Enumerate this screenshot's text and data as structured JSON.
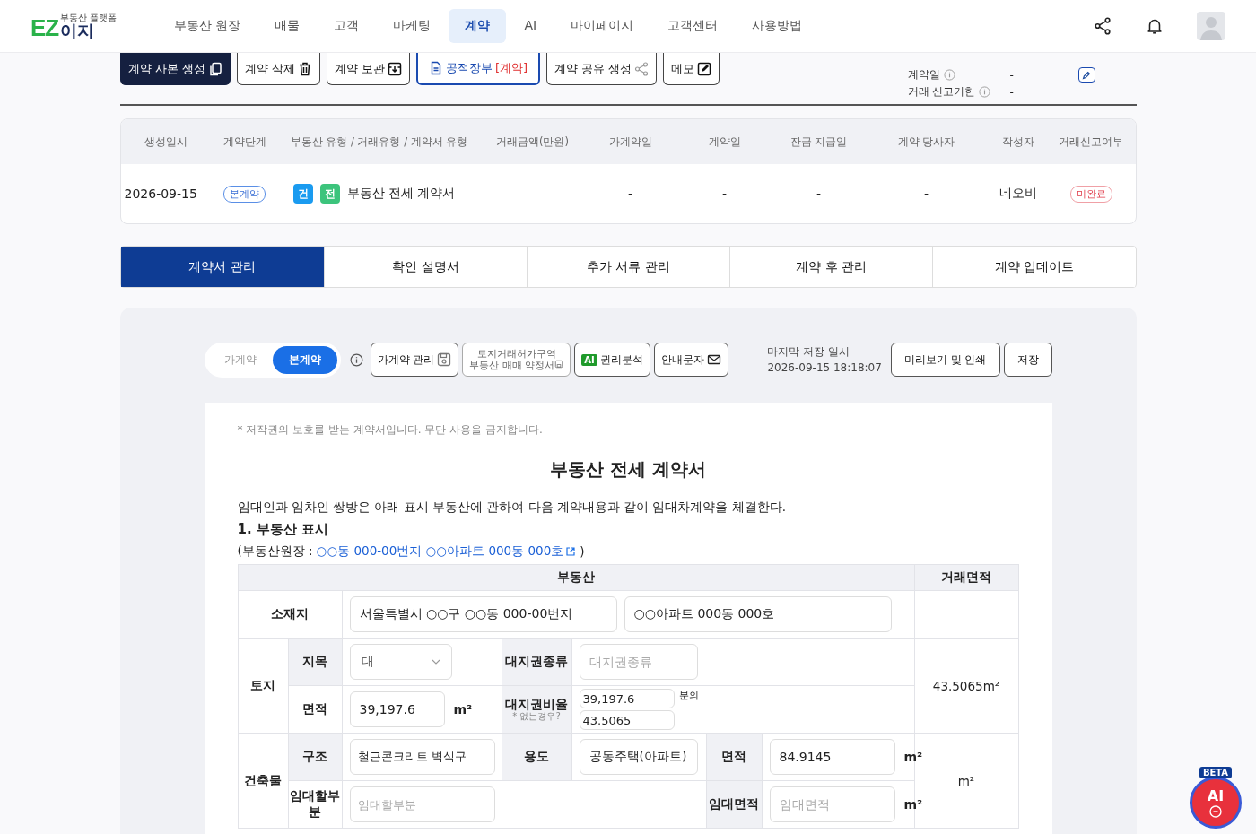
{
  "header": {
    "logo_letters": "EZ",
    "logo_word": "이지",
    "logo_tagline": "부동산 플랫폼",
    "nav": [
      {
        "label": "부동산 원장",
        "selected": false
      },
      {
        "label": "매물",
        "selected": false
      },
      {
        "label": "고객",
        "selected": false
      },
      {
        "label": "마케팅",
        "selected": false
      },
      {
        "label": "계약",
        "selected": true
      },
      {
        "label": "AI",
        "selected": false
      },
      {
        "label": "마이페이지",
        "selected": false
      },
      {
        "label": "고객센터",
        "selected": false
      },
      {
        "label": "사용방법",
        "selected": false
      }
    ]
  },
  "actions": [
    {
      "label": "계약 사본 생성",
      "kind": "dark"
    },
    {
      "label": "계약 삭제",
      "kind": "plain"
    },
    {
      "label": "계약 보관",
      "kind": "plain"
    },
    {
      "label": "공적장부",
      "suffix": "[계약]",
      "kind": "outline"
    },
    {
      "label": "계약 공유 생성",
      "kind": "plain"
    },
    {
      "label": "메모",
      "kind": "plain"
    }
  ],
  "info": [
    {
      "label": "계약일",
      "value": "-",
      "editable": true
    },
    {
      "label": "거래 신고기한",
      "value": "-",
      "editable": false
    }
  ],
  "summary": {
    "columns": [
      "생성일시",
      "계약단계",
      "부동산 유형 / 거래유형 / 계약서 유형",
      "거래금액(만원)",
      "가계약일",
      "계약일",
      "잔금 지급일",
      "계약 당사자",
      "작성자",
      "거래신고여부"
    ],
    "row": {
      "created": "2026-09-15",
      "stage": "본계약",
      "tags": [
        {
          "label": "건",
          "color": "#1a9bf0"
        },
        {
          "label": "전",
          "color": "#3cc47c"
        }
      ],
      "doc_type": "부동산 전세 계약서",
      "pre_date": "-",
      "date": "-",
      "balance_date": "-",
      "parties": "-",
      "author": "네오비",
      "report": "미완료"
    }
  },
  "tabs": [
    {
      "label": "계약서 관리",
      "selected": true
    },
    {
      "label": "확인 설명서",
      "selected": false
    },
    {
      "label": "추가 서류 관리",
      "selected": false
    },
    {
      "label": "계약 후 관리",
      "selected": false
    },
    {
      "label": "계약 업데이트",
      "selected": false
    }
  ],
  "toolbar": {
    "toggle": [
      {
        "label": "가계약",
        "selected": false
      },
      {
        "label": "본계약",
        "selected": true
      }
    ],
    "tools": [
      {
        "label": "가계약 관리",
        "kind": "save",
        "disabled": false
      },
      {
        "label": "토지거래허가구역",
        "label2": "부동산 매매 약정서",
        "kind": "save",
        "disabled": true
      },
      {
        "label": "권리분석",
        "badge": "AI",
        "kind": "ai",
        "disabled": false
      },
      {
        "label": "안내문자",
        "kind": "mail",
        "disabled": false
      }
    ],
    "saved_label": "마지막 저장 일시",
    "saved_value": "2026-09-15 18:18:07",
    "buttons": [
      "미리보기 및 인쇄",
      "저장"
    ]
  },
  "document": {
    "notice": "* 저작권의 보호를 받는 계약서입니다. 무단 사용을 금지합니다.",
    "title": "부동산 전세 계약서",
    "intro": "임대인과 임차인 쌍방은 아래 표시 부동산에 관하여 다음 계약내용과 같이 임대차계약을 체결한다.",
    "section": "1. 부동산 표시",
    "ledger_prefix": "(부동산원장 :",
    "ledger_link": "○○동 000-00번지 ○○아파트 000동 000호",
    "ledger_suffix": ")",
    "form": {
      "property_head": "부동산",
      "area_head": "거래면적",
      "location": {
        "label": "소재지",
        "address": "서울특별시 ○○구 ○○동 000-00번지",
        "unit": "○○아파트 000동 000호"
      },
      "land": {
        "label": "토지",
        "category_label": "지목",
        "category": "대",
        "right_type_label": "대지권종류",
        "right_type_placeholder": "대지권종류",
        "area_label": "면적",
        "area": "39,197.6",
        "area_unit": "m²",
        "ratio_label": "대지권비율",
        "ratio_note": "* 없는경우?",
        "ratio_denominator": "39,197.6",
        "ratio_word": "분의",
        "ratio_numerator": "43.5065",
        "trade_area": "43.5065m²"
      },
      "building": {
        "label": "건축물",
        "structure_label": "구조",
        "structure": "철근콘크리트 벽식구",
        "use_label": "용도",
        "use": "공동주택(아파트)",
        "area_label": "면적",
        "area": "84.9145",
        "area_unit": "m²",
        "lease_part_label": "임대할부분",
        "lease_part_placeholder": "임대할부분",
        "lease_area_label": "임대면적",
        "lease_area_placeholder": "임대면적",
        "lease_area_unit": "m²",
        "trade_area": "m²"
      }
    }
  },
  "ai_button": {
    "badge": "BETA",
    "label": "AI"
  }
}
